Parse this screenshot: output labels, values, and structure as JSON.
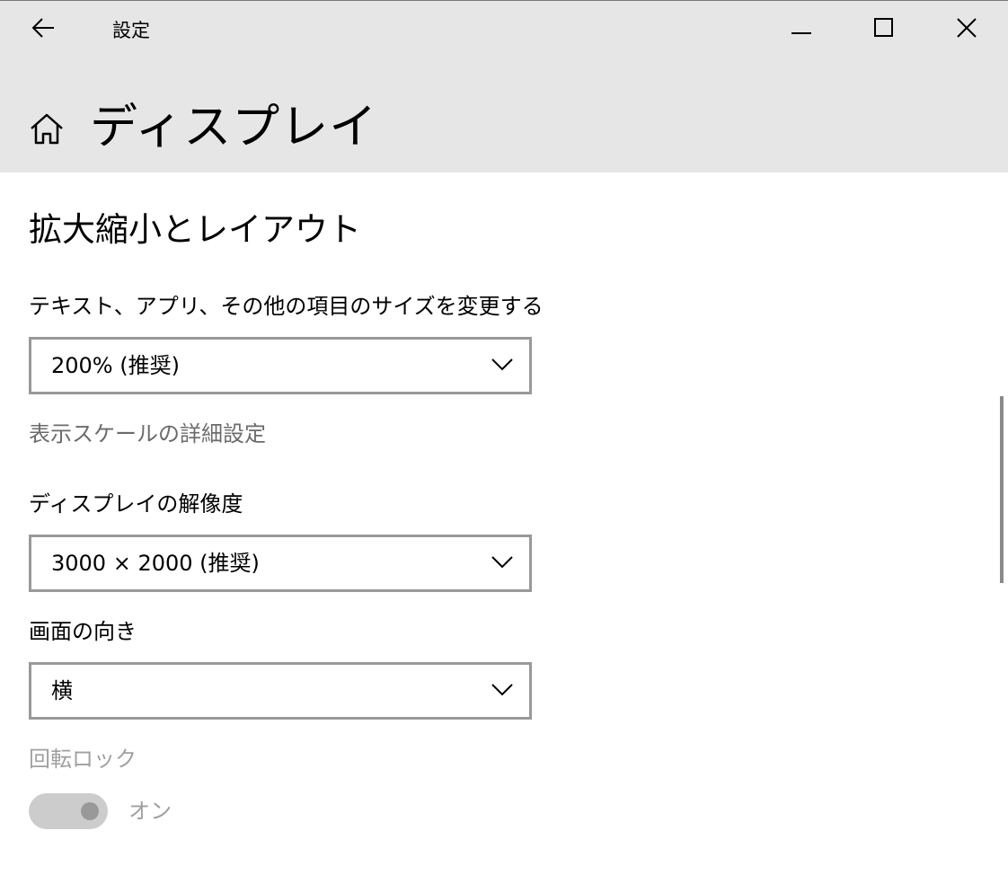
{
  "titlebar": {
    "app_title": "設定",
    "back_icon": "back-arrow-icon",
    "minimize_icon": "minimize-icon",
    "maximize_icon": "maximize-icon",
    "close_icon": "close-icon"
  },
  "header": {
    "home_icon": "home-icon",
    "page_title": "ディスプレイ"
  },
  "section": {
    "heading": "拡大縮小とレイアウト"
  },
  "scale": {
    "label": "テキスト、アプリ、その他の項目のサイズを変更する",
    "selected": "200% (推奨)",
    "advanced_link": "表示スケールの詳細設定"
  },
  "resolution": {
    "label": "ディスプレイの解像度",
    "selected": "3000 × 2000 (推奨)"
  },
  "orientation": {
    "label": "画面の向き",
    "selected": "横"
  },
  "rotation_lock": {
    "label": "回転ロック",
    "state_label": "オン",
    "enabled": false,
    "on": true
  },
  "colors": {
    "header_bg": "#e6e6e6",
    "dropdown_border": "#999999",
    "disabled_text": "#a0a0a0",
    "link_text": "#6b6b6b"
  }
}
